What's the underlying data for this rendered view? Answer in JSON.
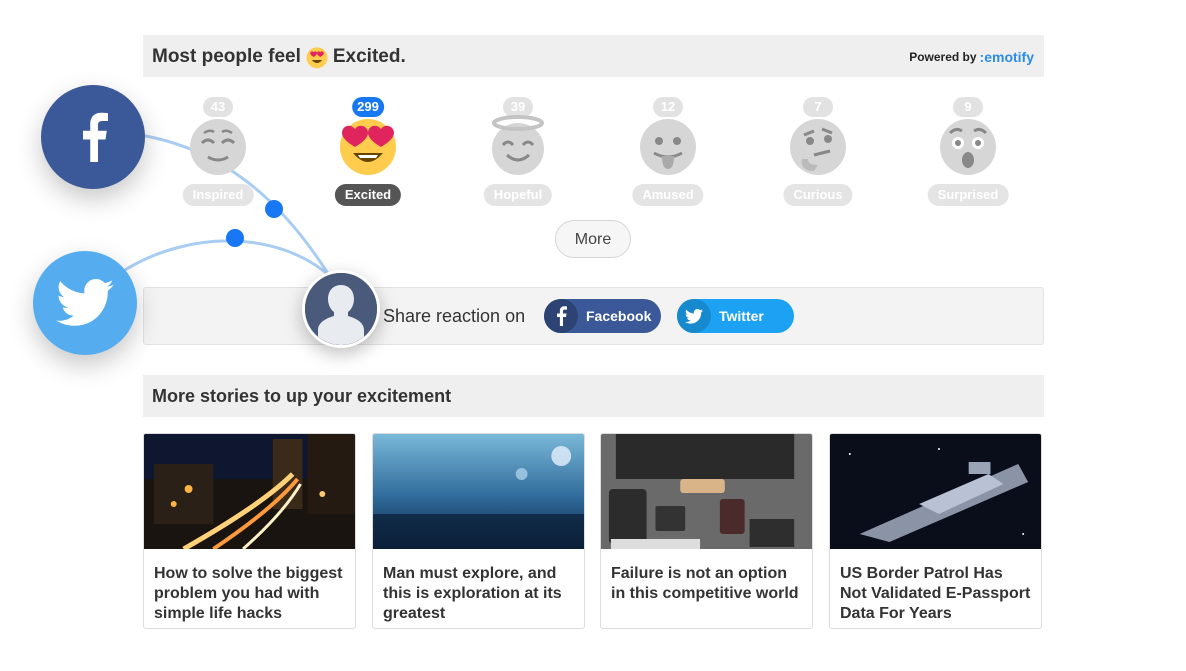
{
  "header": {
    "prefix": "Most people feel",
    "emotion": "Excited.",
    "powered_by": "Powered by",
    "brand": ":emotify"
  },
  "reactions": [
    {
      "label": "Inspired",
      "count": "43",
      "active": false,
      "icon": "relieved-face-icon"
    },
    {
      "label": "Excited",
      "count": "299",
      "active": true,
      "icon": "heart-eyes-face-icon"
    },
    {
      "label": "Hopeful",
      "count": "39",
      "active": false,
      "icon": "halo-face-icon"
    },
    {
      "label": "Amused",
      "count": "12",
      "active": false,
      "icon": "tongue-face-icon"
    },
    {
      "label": "Curious",
      "count": "7",
      "active": false,
      "icon": "thinking-face-icon"
    },
    {
      "label": "Surprised",
      "count": "9",
      "active": false,
      "icon": "surprised-face-icon"
    }
  ],
  "more_label": "More",
  "share": {
    "text": "Share reaction on",
    "facebook": "Facebook",
    "twitter": "Twitter"
  },
  "stories": {
    "title": "More stories to up your excitement",
    "items": [
      {
        "title": "How to solve the biggest problem you had with simple life hacks",
        "image": "night-city-traffic"
      },
      {
        "title": "Man must explore, and this is exploration at its greatest",
        "image": "blue-bokeh-ground"
      },
      {
        "title": "Failure is not an option in this competitive world",
        "image": "desk-workspace"
      },
      {
        "title": "US Border Patrol Has Not Validated E-Passport Data For Years",
        "image": "star-destroyer-space"
      }
    ]
  },
  "colors": {
    "facebook": "#3b5998",
    "twitter": "#1da1f2",
    "active_count": "#1877f2",
    "connector_line": "#a9cdf2",
    "connector_dot": "#1877f2"
  }
}
